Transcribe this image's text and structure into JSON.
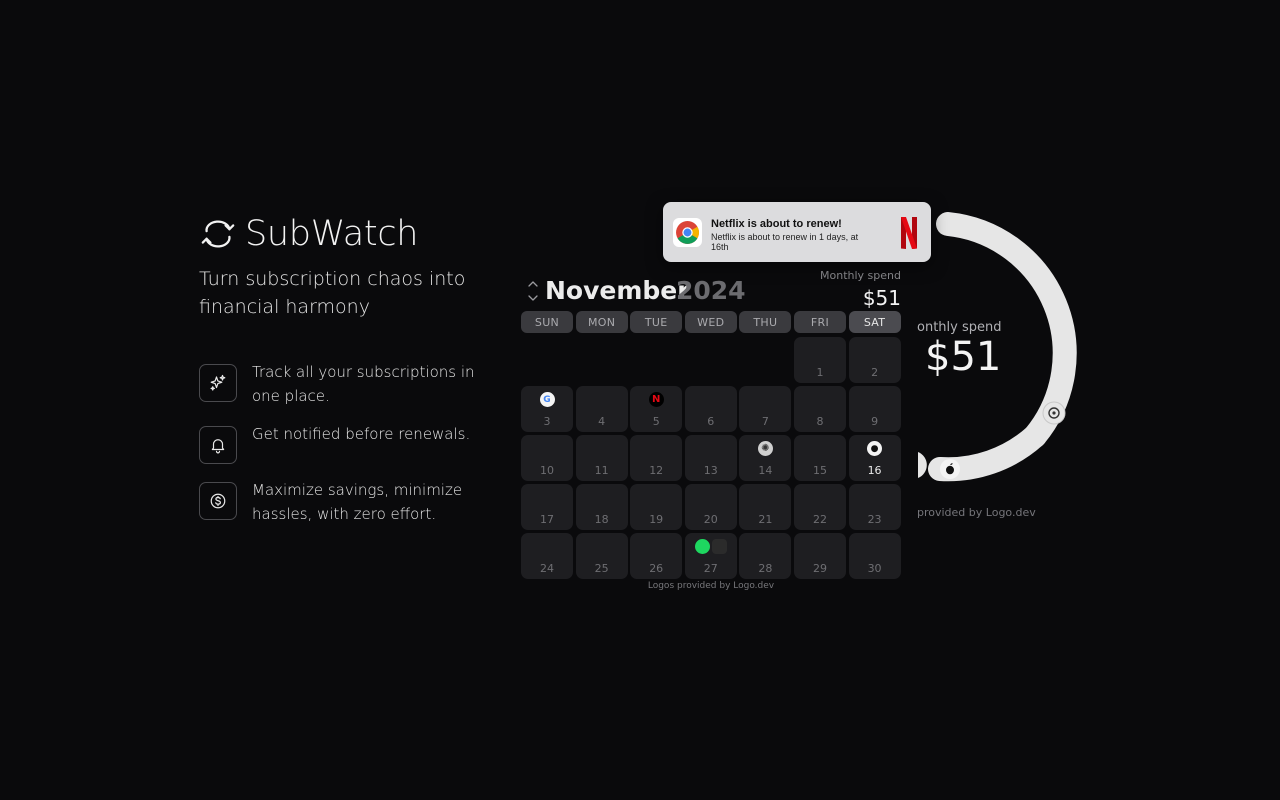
{
  "brand": {
    "name": "SubWatch",
    "tagline": "Turn subscription chaos into financial harmony"
  },
  "features": [
    {
      "icon": "sparkles-icon",
      "text": "Track all your subscriptions in one place."
    },
    {
      "icon": "bell-icon",
      "text": "Get notified before renewals."
    },
    {
      "icon": "dollar-icon",
      "text": "Maximize savings, minimize hassles, with zero effort."
    }
  ],
  "calendar": {
    "month": "November",
    "year": "2024",
    "spend_label": "Monthly spend",
    "spend_value": "$51",
    "weekdays": [
      "SUN",
      "MON",
      "TUE",
      "WED",
      "THU",
      "FRI",
      "SAT"
    ],
    "credit": "Logos provided by Logo.dev",
    "renewals": {
      "3": [
        "google"
      ],
      "5": [
        "netflix"
      ],
      "14": [
        "openai"
      ],
      "16": [
        "apple"
      ],
      "27": [
        "spotify",
        "figma"
      ]
    }
  },
  "ring": {
    "label": "onthly spend",
    "value": "$51",
    "credit": "provided by Logo.dev"
  },
  "notification": {
    "app_icon": "chrome-icon",
    "title": "Netflix is about to renew!",
    "body": "Netflix is about to renew in 1 days, at 16th",
    "brand_logo": "netflix-icon"
  },
  "colors": {
    "background": "#0a0a0c",
    "cell": "#1e1e21",
    "weekday": "#3a3a3e",
    "netflix": "#e50914"
  }
}
